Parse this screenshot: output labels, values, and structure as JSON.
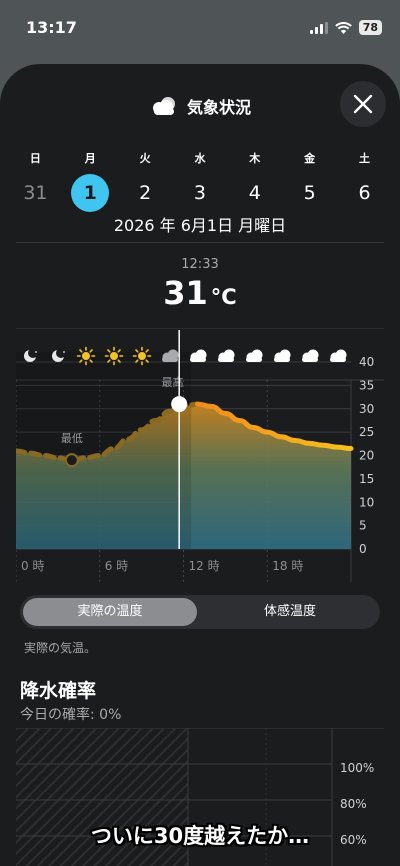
{
  "status_bar": {
    "time": "13:17",
    "battery": "78"
  },
  "sheet": {
    "title": "気象状況",
    "title_icon": "cloud-icon",
    "close_icon": "close-icon"
  },
  "days": [
    {
      "name": "日",
      "num": "31",
      "state": "past"
    },
    {
      "name": "月",
      "num": "1",
      "state": "selected"
    },
    {
      "name": "火",
      "num": "2",
      "state": "normal"
    },
    {
      "name": "水",
      "num": "3",
      "state": "normal"
    },
    {
      "name": "木",
      "num": "4",
      "state": "normal"
    },
    {
      "name": "金",
      "num": "5",
      "state": "normal"
    },
    {
      "name": "土",
      "num": "6",
      "state": "normal"
    }
  ],
  "date_full": "2026 年 6月1日 月曜日",
  "selection": {
    "time": "12:33",
    "temp": "31",
    "unit": "°C"
  },
  "chart_data": {
    "type": "line",
    "x_ticks": [
      "0 時",
      "6 時",
      "12 時",
      "18 時"
    ],
    "x_tick_hours": [
      0,
      6,
      12,
      18
    ],
    "y_ticks": [
      0,
      5,
      10,
      15,
      20,
      25,
      30,
      35,
      40
    ],
    "ylim": [
      0,
      40
    ],
    "xlim": [
      0,
      24
    ],
    "series": [
      {
        "hours": [
          0,
          1,
          2,
          3,
          4,
          5,
          6,
          7,
          8,
          9,
          10,
          11,
          12,
          13,
          14,
          15,
          16,
          17,
          18,
          19,
          20,
          21,
          22,
          23,
          24
        ],
        "values": [
          21,
          20.5,
          20,
          19.5,
          19,
          19.5,
          20,
          21.5,
          23.5,
          25.5,
          27.5,
          29.5,
          30.5,
          31,
          30.5,
          29,
          27.5,
          26,
          25,
          24,
          23.2,
          22.6,
          22.2,
          21.8,
          21.5
        ]
      }
    ],
    "annotations": {
      "min_label": "最低",
      "min_hour": 4,
      "max_label": "最高",
      "max_hour": 12.5
    },
    "current_hour": 12.55,
    "weather_icons": [
      "moon",
      "moon",
      "sun",
      "sun",
      "sun",
      "cloud",
      "cloud",
      "cloud",
      "cloud",
      "cloud",
      "cloud",
      "cloud"
    ]
  },
  "toggle": {
    "active": "実際の温度",
    "inactive": "体感温度"
  },
  "description": "実際の気温。",
  "precip": {
    "title": "降水確率",
    "subtitle": "今日の確率: 0%",
    "y_ticks": [
      "100%",
      "80%",
      "60%"
    ]
  },
  "caption": "ついに30度越えたか…"
}
